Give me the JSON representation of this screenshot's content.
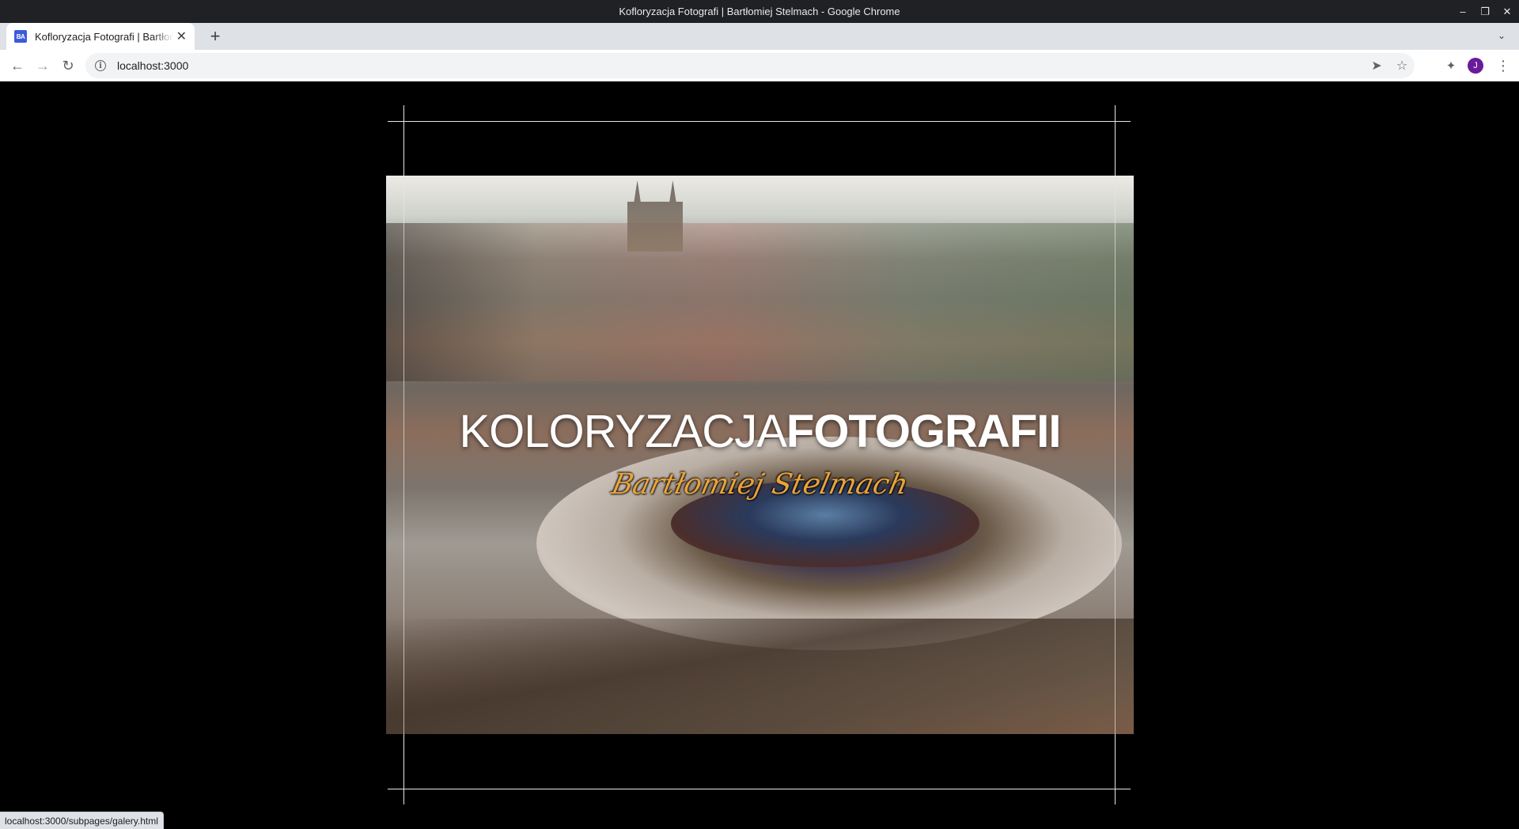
{
  "window": {
    "title": "Kofloryzacja Fotografi | Bartłomiej Stelmach - Google Chrome",
    "controls": {
      "minimize": "–",
      "restore": "❐",
      "close": "✕"
    }
  },
  "tab": {
    "favicon_text": "BA",
    "title": "Kofloryzacja Fotografi | Bartłomiej Stelmach",
    "close": "✕",
    "new_tab": "+",
    "search_tabs": "⌄"
  },
  "toolbar": {
    "back": "←",
    "forward": "→",
    "reload": "↻",
    "info": "i",
    "url": "localhost:3000",
    "send_icon": "➤",
    "star_icon": "☆",
    "extensions_icon": "✦",
    "avatar_letter": "J",
    "menu_icon": "⋮"
  },
  "hero": {
    "title_light": "KOLORYZACJA",
    "title_bold": "FOTOGRAFII",
    "signature": "Bartłomiej Stelmach"
  },
  "status_bar": {
    "url": "localhost:3000/subpages/galery.html"
  },
  "colors": {
    "accent_signature": "#e8a33a",
    "avatar": "#6a1b9a",
    "favicon": "#3b5bdb"
  }
}
